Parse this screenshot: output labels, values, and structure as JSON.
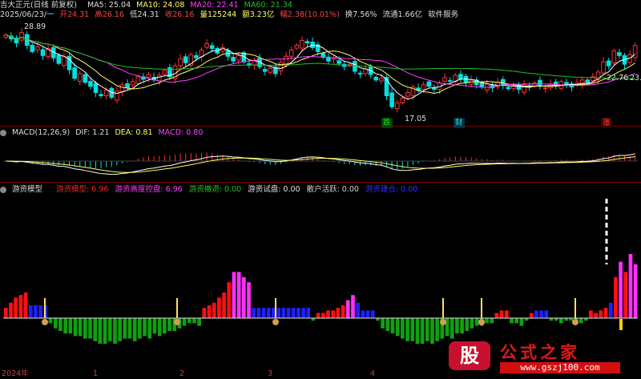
{
  "header": {
    "title": "吉大正元(日线 前复权)",
    "ma5": "MA5: 25.04",
    "ma10": "MA10: 24.08",
    "ma20": "MA20: 22.41",
    "ma60": "MA60: 21.34",
    "date": "2025/06/23/一",
    "open": "开24.31",
    "high": "高26.16",
    "low": "低24.31",
    "close": "收26.16",
    "volume": "量125244",
    "amount": "额3.23亿",
    "change": "幅2.38(10.01%)",
    "turnover": "换7.56%",
    "float": "流通1.66亿",
    "sector": "软件服务"
  },
  "price_panel": {
    "high_mark": "28.89",
    "low_mark": "17.05",
    "right_labels": [
      "22.76",
      "23."
    ],
    "markers": [
      "跌",
      "财",
      "涨"
    ]
  },
  "macd_panel": {
    "title": "MACD(12,26,9)",
    "dif": "DIF: 1.21",
    "dea": "DEA: 0.81",
    "macd": "MACD: 0.80"
  },
  "model_panel": {
    "title": "游资模型",
    "labels": [
      {
        "text": "游资模型: 6.96",
        "color": "#e03030"
      },
      {
        "text": "游资高度控盘: 6.96",
        "color": "#ff40ff"
      },
      {
        "text": "游资撤退: 0.00",
        "color": "#20c020"
      },
      {
        "text": "游资试盘: 0.00",
        "color": "#e0e0e0"
      },
      {
        "text": "散户活跃: 0.00",
        "color": "#d0d0d0"
      },
      {
        "text": "游资建仓: 0.00",
        "color": "#3030ff"
      }
    ]
  },
  "time_axis": [
    "2024年",
    "1",
    "2",
    "3",
    "4"
  ],
  "watermark": {
    "logo": "股",
    "name": "公式之家",
    "url": "www.gszj100.com"
  },
  "colors": {
    "up": "#ff3030",
    "down": "#00e0e0",
    "ma5": "#ffffff",
    "ma10": "#ffff60",
    "ma20": "#ff40ff",
    "ma60": "#20c020"
  },
  "chart_data": [
    {
      "type": "candlestick",
      "title": "吉大正元(日线 前复权)",
      "series_names": [
        "MA5",
        "MA10",
        "MA20",
        "MA60"
      ],
      "close": [
        27.5,
        27.0,
        26.5,
        27.8,
        26.2,
        25.4,
        26.0,
        24.9,
        25.8,
        24.6,
        23.9,
        24.8,
        23.1,
        22.0,
        22.6,
        21.5,
        21.0,
        20.2,
        19.8,
        20.5,
        19.6,
        20.4,
        21.2,
        20.8,
        21.6,
        22.2,
        21.9,
        22.5,
        21.8,
        22.4,
        23.0,
        22.2,
        23.6,
        24.5,
        24.0,
        25.0,
        24.6,
        25.6,
        26.4,
        25.8,
        25.2,
        25.9,
        24.8,
        24.2,
        24.9,
        24.1,
        23.7,
        24.3,
        23.5,
        22.9,
        23.3,
        22.6,
        24.0,
        24.8,
        25.6,
        26.2,
        26.8,
        26.5,
        25.9,
        25.4,
        24.7,
        24.2,
        24.6,
        23.9,
        23.5,
        23.8,
        22.9,
        22.6,
        23.2,
        22.5,
        21.8,
        22.0,
        19.8,
        18.4,
        18.9,
        19.5,
        20.2,
        20.9,
        20.5,
        21.2,
        21.0,
        20.6,
        21.4,
        22.1,
        21.7,
        22.4,
        21.9,
        21.5,
        21.8,
        21.2,
        20.9,
        21.3,
        20.8,
        21.5,
        21.1,
        20.7,
        21.0,
        20.6,
        21.2,
        20.9,
        21.4,
        21.0,
        20.8,
        21.3,
        21.1,
        21.6,
        21.2,
        20.9,
        21.4,
        21.8,
        21.5,
        22.2,
        22.8,
        24.1,
        23.6,
        25.5,
        24.9,
        23.8,
        25.0,
        26.16
      ],
      "ma_values": {
        "MA5": 25.04,
        "MA10": 24.08,
        "MA20": 22.41,
        "MA60": 21.34
      },
      "annotations": {
        "high": 28.89,
        "low": 17.05
      }
    },
    {
      "type": "line+bar",
      "title": "MACD(12,26,9)",
      "series_names": [
        "DIF",
        "DEA",
        "MACD"
      ],
      "values": {
        "DIF": 1.21,
        "DEA": 0.81,
        "MACD": 0.8
      }
    },
    {
      "type": "bar",
      "title": "游资模型",
      "series_names": [
        "游资模型",
        "游资高度控盘",
        "游资撤退",
        "游资试盘",
        "散户活跃",
        "游资建仓"
      ],
      "values": [
        4,
        6,
        8,
        9,
        10,
        5,
        5,
        5,
        5,
        -2,
        -4,
        -5,
        -6,
        -6,
        -7,
        -7,
        -8,
        -8,
        -9,
        -10,
        -10,
        -9,
        -10,
        -9,
        -8,
        -8,
        -9,
        -8,
        -7,
        -8,
        -6,
        -7,
        -6,
        -5,
        -5,
        -4,
        -3,
        -2,
        -2,
        -3,
        4,
        5,
        6,
        8,
        10,
        14,
        18,
        18,
        16,
        14,
        4,
        4,
        4,
        4,
        4,
        4,
        4,
        4,
        4,
        4,
        4,
        4,
        -1,
        2,
        2,
        3,
        3,
        4,
        5,
        7,
        9,
        6,
        3,
        3,
        3,
        -1,
        -4,
        -5,
        -6,
        -7,
        -8,
        -9,
        -9,
        -10,
        -10,
        -9,
        -10,
        -9,
        -8,
        -7,
        -8,
        -6,
        -6,
        -5,
        -4,
        -3,
        -3,
        -2,
        -2,
        2,
        3,
        3,
        -2,
        -2,
        -3,
        -1,
        2,
        3,
        3,
        3,
        -1,
        -1,
        -2,
        -1,
        -1,
        -1,
        -2,
        -1,
        3,
        2,
        3,
        4,
        6,
        16,
        22,
        18,
        25,
        21
      ],
      "categories_type": [
        "red",
        "red",
        "red",
        "red",
        "red",
        "blue",
        "blue",
        "blue",
        "blue",
        "green",
        "green",
        "green",
        "green",
        "green",
        "green",
        "green",
        "green",
        "green",
        "green",
        "green",
        "green",
        "green",
        "green",
        "green",
        "green",
        "green",
        "green",
        "green",
        "green",
        "green",
        "green",
        "green",
        "green",
        "green",
        "green",
        "green",
        "green",
        "green",
        "green",
        "green",
        "red",
        "red",
        "red",
        "red",
        "red",
        "red",
        "magenta",
        "magenta",
        "magenta",
        "magenta",
        "blue",
        "blue",
        "blue",
        "blue",
        "blue",
        "blue",
        "blue",
        "blue",
        "blue",
        "blue",
        "blue",
        "blue",
        "green",
        "red",
        "red",
        "red",
        "red",
        "red",
        "red",
        "magenta",
        "magenta",
        "blue",
        "blue",
        "blue",
        "blue",
        "green",
        "green",
        "green",
        "green",
        "green",
        "green",
        "green",
        "green",
        "green",
        "green",
        "green",
        "green",
        "green",
        "green",
        "green",
        "green",
        "green",
        "green",
        "green",
        "green",
        "green",
        "green",
        "green",
        "green",
        "red",
        "red",
        "red",
        "green",
        "green",
        "green",
        "green",
        "red",
        "blue",
        "blue",
        "blue",
        "green",
        "green",
        "green",
        "green",
        "green",
        "green",
        "green",
        "green",
        "red",
        "red",
        "red",
        "red",
        "blue",
        "red",
        "magenta",
        "red",
        "magenta",
        "magenta"
      ]
    }
  ]
}
